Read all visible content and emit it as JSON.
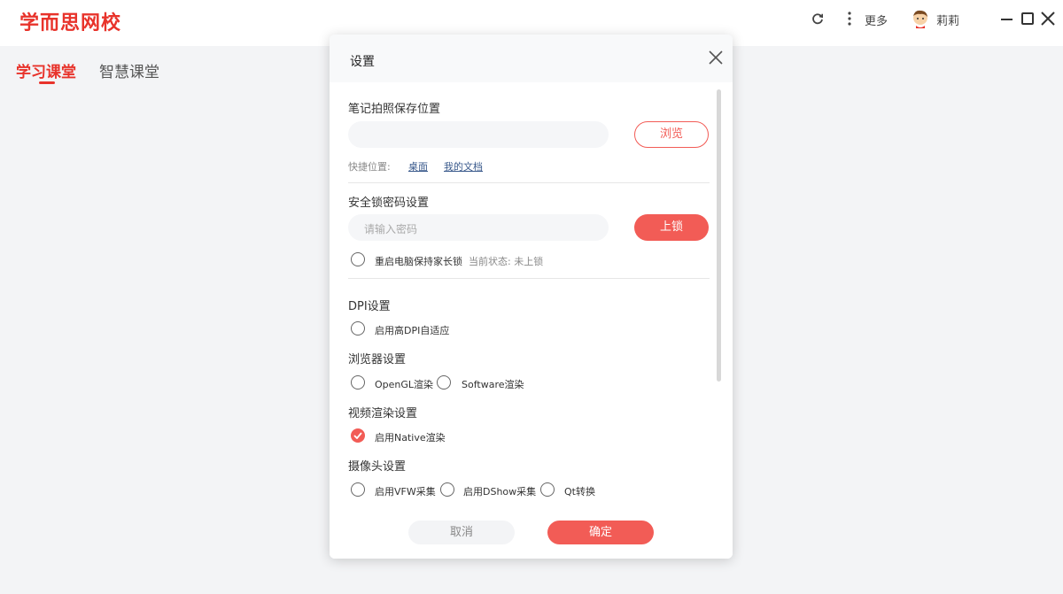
{
  "app": {
    "logo": "学而思网校"
  },
  "titlebar": {
    "more_label": "更多",
    "user_name": "莉莉"
  },
  "tabs": [
    {
      "label": "学习课堂"
    },
    {
      "label": "智慧课堂"
    }
  ],
  "dialog": {
    "title": "设置",
    "photo_save": {
      "label": "笔记拍照保存位置",
      "path_value": "",
      "browse_label": "浏览",
      "quick_label": "快捷位置:",
      "quick_desktop": "桌面",
      "quick_documents": "我的文档"
    },
    "security_lock": {
      "label": "安全锁密码设置",
      "password_placeholder": "请输入密码",
      "lock_label": "上锁",
      "keep_lock_label": "重启电脑保持家长锁",
      "status_text": "当前状态: 未上锁"
    },
    "dpi": {
      "label": "DPI设置",
      "option": "启用高DPI自适应"
    },
    "browser": {
      "label": "浏览器设置",
      "options": [
        "OpenGL渲染",
        "Software渲染"
      ]
    },
    "video": {
      "label": "视频渲染设置",
      "option": "启用Native渲染",
      "checked": true
    },
    "camera": {
      "label": "摄像头设置",
      "options": [
        "启用VFW采集",
        "启用DShow采集",
        "Qt转换"
      ]
    },
    "cancel_label": "取消",
    "ok_label": "确定"
  },
  "colors": {
    "brand": "#e8332b",
    "accent": "#f25c56"
  }
}
